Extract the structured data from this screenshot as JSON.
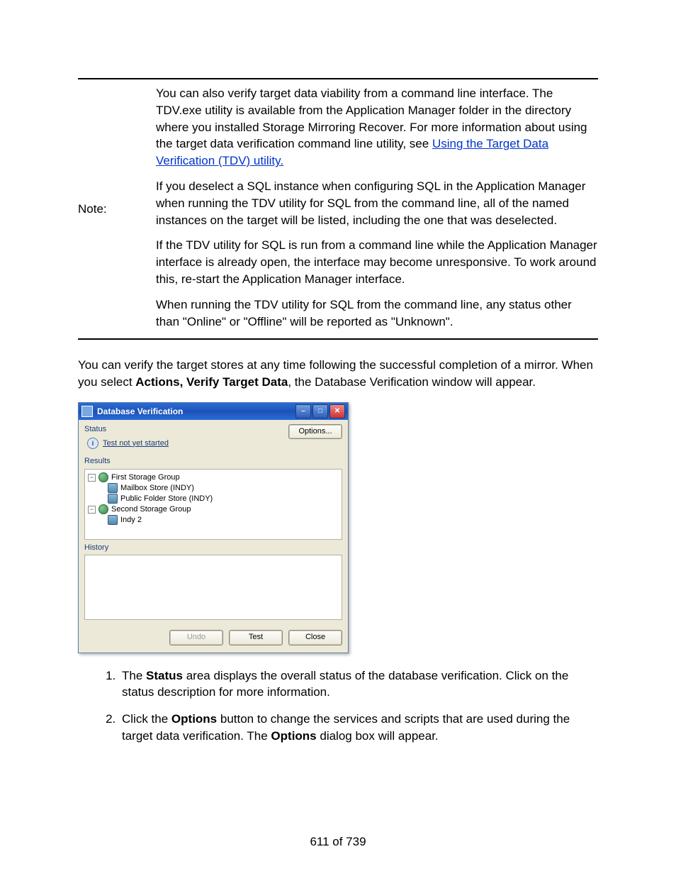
{
  "note": {
    "label": "Note:",
    "p1_prefix": "You can also verify target data viability from a command line interface. The TDV.exe utility is available from the Application Manager folder in the directory where you installed Storage Mirroring Recover. For more information about using the target data verification command line utility, see ",
    "p1_link": "Using the Target Data Verification (TDV) utility.",
    "p2": "If you deselect a SQL instance when configuring SQL in the Application Manager when running the TDV utility for SQL from the command line, all of the named instances on the target will be listed, including the one that was deselected.",
    "p3": "If the TDV utility for SQL is run from a command line while the Application Manager interface is already open, the interface may become unresponsive. To work around this, re-start the Application Manager interface.",
    "p4": "When running the TDV utility for SQL from the command line, any status other than \"Online\" or \"Offline\" will be reported as \"Unknown\"."
  },
  "intro": {
    "before_bold": "You can verify the target stores at any time following the successful completion of a mirror. When you select ",
    "bold": "Actions, Verify Target Data",
    "after_bold": ", the Database Verification window will appear."
  },
  "dialog": {
    "title": "Database Verification",
    "status_label": "Status",
    "status_text": "Test not yet started",
    "options_btn": "Options...",
    "results_label": "Results",
    "history_label": "History",
    "undo_btn": "Undo",
    "test_btn": "Test",
    "close_btn": "Close",
    "tree": {
      "g1": "First Storage Group",
      "g1a": "Mailbox Store (INDY)",
      "g1b": "Public Folder Store (INDY)",
      "g2": "Second Storage Group",
      "g2a": "Indy 2"
    }
  },
  "steps": {
    "s1_before": "The ",
    "s1_bold": "Status",
    "s1_after": " area displays the overall status of the database verification. Click on the status description for more information.",
    "s2_before": "Click the ",
    "s2_bold1": "Options",
    "s2_mid": " button to change the services and scripts that are used during the target data verification. The ",
    "s2_bold2": "Options",
    "s2_after": " dialog box will appear."
  },
  "page_number": "611 of 739"
}
